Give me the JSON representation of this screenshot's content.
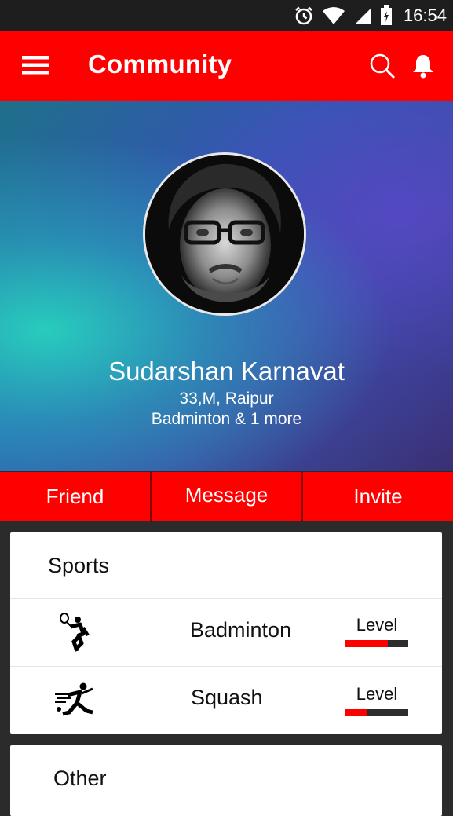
{
  "status_bar": {
    "time": "16:54",
    "icons": [
      "alarm-icon",
      "wifi-icon",
      "signal-icon",
      "battery-icon"
    ]
  },
  "app_bar": {
    "title": "Community",
    "icons": [
      "menu-icon",
      "search-icon",
      "bell-icon"
    ],
    "background": "#ff0000"
  },
  "profile": {
    "name": "Sudarshan Karnavat",
    "details": "33,M, Raipur",
    "sports_summary": "Badminton & 1 more"
  },
  "actions": {
    "friend": "Friend",
    "message": "Message",
    "invite": "Invite"
  },
  "sports_card": {
    "title": "Sports",
    "items": [
      {
        "name": "Badminton",
        "icon": "badminton-player-icon",
        "level_label": "Level",
        "level": 0.67
      },
      {
        "name": "Squash",
        "icon": "squash-player-icon",
        "level_label": "Level",
        "level": 0.34
      }
    ]
  },
  "other_card": {
    "title": "Other"
  },
  "colors": {
    "accent": "#ff0000",
    "level_track": "#2d2d2d"
  }
}
